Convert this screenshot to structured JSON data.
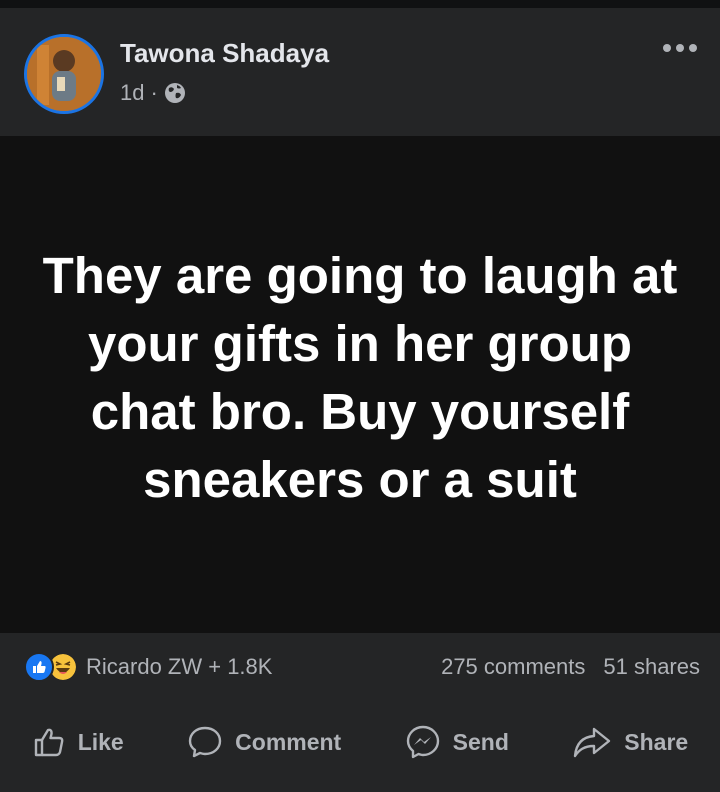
{
  "post": {
    "author": "Tawona Shadaya",
    "time": "1d",
    "separator": "·",
    "privacy_icon": "globe-icon",
    "more_icon": "more-horizontal-icon",
    "body_text": "They are going to laugh at your gifts in her group chat bro. Buy yourself sneakers or a suit"
  },
  "engagement": {
    "reaction_icons": [
      "like-reaction-icon",
      "haha-reaction-icon"
    ],
    "reaction_summary": "Ricardo ZW + 1.8K",
    "comments": "275 comments",
    "shares": "51 shares"
  },
  "actions": [
    {
      "label": "Like",
      "icon": "thumbs-up-icon"
    },
    {
      "label": "Comment",
      "icon": "comment-bubble-icon"
    },
    {
      "label": "Send",
      "icon": "messenger-icon"
    },
    {
      "label": "Share",
      "icon": "share-arrow-icon"
    }
  ],
  "colors": {
    "background": "#18191a",
    "card": "#242526",
    "post_body": "#111111",
    "accent": "#1b74e4",
    "text_primary": "#e4e6eb",
    "text_secondary": "#b0b3b8"
  }
}
